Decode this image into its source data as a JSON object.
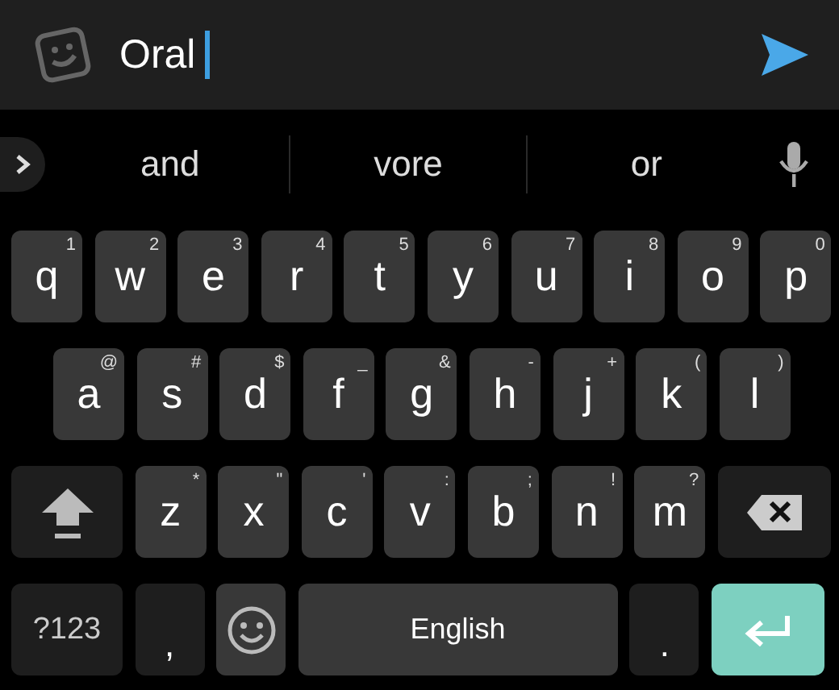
{
  "input_bar": {
    "value": "Oral"
  },
  "suggestions": [
    {
      "text": "and"
    },
    {
      "text": "vore"
    },
    {
      "text": "or"
    }
  ],
  "rows": [
    [
      {
        "kind": "letter",
        "label": "q",
        "hint": "1"
      },
      {
        "kind": "letter",
        "label": "w",
        "hint": "2"
      },
      {
        "kind": "letter",
        "label": "e",
        "hint": "3"
      },
      {
        "kind": "letter",
        "label": "r",
        "hint": "4"
      },
      {
        "kind": "letter",
        "label": "t",
        "hint": "5"
      },
      {
        "kind": "letter",
        "label": "y",
        "hint": "6"
      },
      {
        "kind": "letter",
        "label": "u",
        "hint": "7"
      },
      {
        "kind": "letter",
        "label": "i",
        "hint": "8"
      },
      {
        "kind": "letter",
        "label": "o",
        "hint": "9"
      },
      {
        "kind": "letter",
        "label": "p",
        "hint": "0"
      }
    ],
    [
      {
        "kind": "letter",
        "label": "a",
        "hint": "@"
      },
      {
        "kind": "letter",
        "label": "s",
        "hint": "#"
      },
      {
        "kind": "letter",
        "label": "d",
        "hint": "$"
      },
      {
        "kind": "letter",
        "label": "f",
        "hint": "_"
      },
      {
        "kind": "letter",
        "label": "g",
        "hint": "&"
      },
      {
        "kind": "letter",
        "label": "h",
        "hint": "-"
      },
      {
        "kind": "letter",
        "label": "j",
        "hint": "+"
      },
      {
        "kind": "letter",
        "label": "k",
        "hint": "("
      },
      {
        "kind": "letter",
        "label": "l",
        "hint": ")"
      }
    ],
    [
      {
        "kind": "shift"
      },
      {
        "kind": "letter",
        "label": "z",
        "hint": "*"
      },
      {
        "kind": "letter",
        "label": "x",
        "hint": "\""
      },
      {
        "kind": "letter",
        "label": "c",
        "hint": "'"
      },
      {
        "kind": "letter",
        "label": "v",
        "hint": ":"
      },
      {
        "kind": "letter",
        "label": "b",
        "hint": ";"
      },
      {
        "kind": "letter",
        "label": "n",
        "hint": "!"
      },
      {
        "kind": "letter",
        "label": "m",
        "hint": "?"
      },
      {
        "kind": "backspace"
      }
    ],
    [
      {
        "kind": "symbols",
        "label": "?123"
      },
      {
        "kind": "punct",
        "label": ","
      },
      {
        "kind": "emoji"
      },
      {
        "kind": "space",
        "label": "English"
      },
      {
        "kind": "punct",
        "label": "."
      },
      {
        "kind": "enter"
      }
    ]
  ]
}
